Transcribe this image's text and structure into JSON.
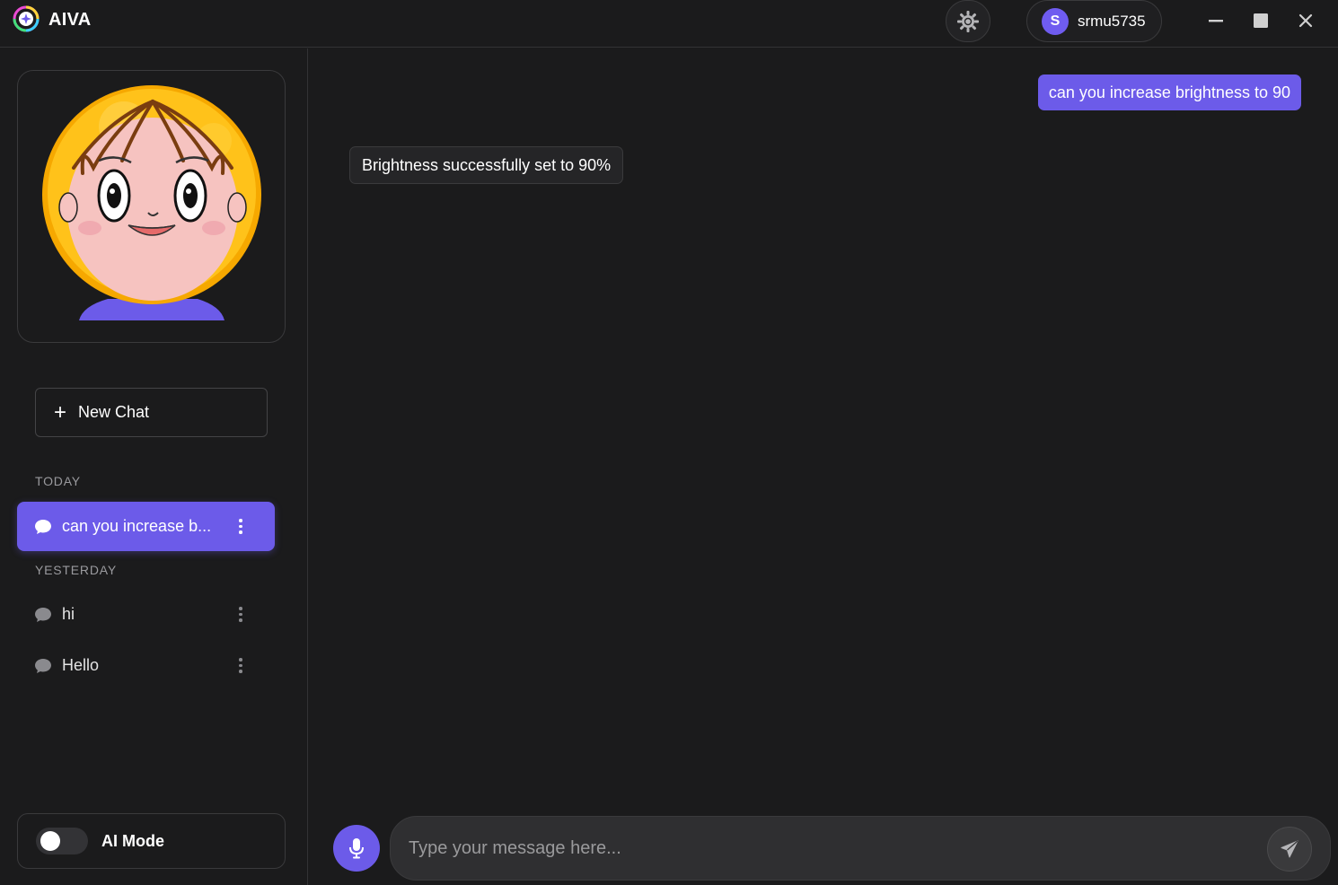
{
  "app": {
    "title": "AIVA"
  },
  "header": {
    "theme_icon": "gear-sun-icon",
    "user": {
      "initial": "S",
      "name": "srmu5735"
    },
    "window_controls": [
      "minimize-icon",
      "maximize-icon",
      "close-icon"
    ]
  },
  "sidebar": {
    "new_chat_label": "New Chat",
    "sections": [
      {
        "label": "TODAY",
        "items": [
          {
            "label": "can you increase b...",
            "active": true
          }
        ]
      },
      {
        "label": "YESTERDAY",
        "items": [
          {
            "label": "hi",
            "active": false
          },
          {
            "label": "Hello",
            "active": false
          }
        ]
      }
    ],
    "ai_mode": {
      "label": "AI Mode",
      "enabled": false
    }
  },
  "chat": {
    "messages": [
      {
        "role": "user",
        "text": "can you increase brightness to 90"
      },
      {
        "role": "assistant",
        "text": "Brightness successfully set to 90%"
      }
    ],
    "input_placeholder": "Type your message here..."
  },
  "colors": {
    "accent": "#6c5be9",
    "background": "#1b1b1c",
    "border": "#3a3a3c"
  }
}
